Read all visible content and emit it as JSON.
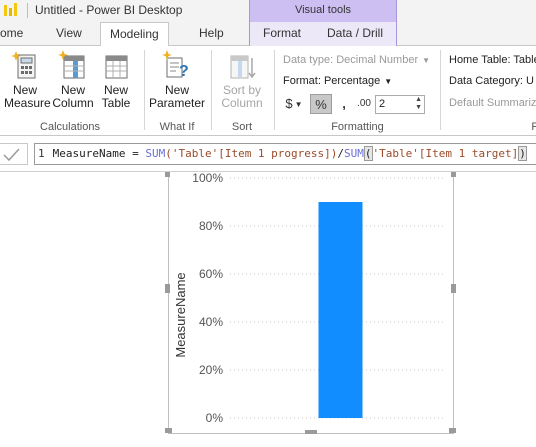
{
  "window": {
    "title": "Untitled - Power BI Desktop"
  },
  "contextual_header": {
    "label": "Visual tools"
  },
  "tabs": [
    {
      "label": "ome",
      "active": false
    },
    {
      "label": "View",
      "active": false
    },
    {
      "label": "Modeling",
      "active": true
    },
    {
      "label": "Help",
      "active": false
    },
    {
      "label": "Format",
      "active": false
    },
    {
      "label": "Data / Drill",
      "active": false
    }
  ],
  "ribbon": {
    "calculations": {
      "new_measure": [
        "New",
        "Measure"
      ],
      "new_column": [
        "New",
        "Column"
      ],
      "new_table": [
        "New",
        "Table"
      ],
      "label": "Calculations"
    },
    "what_if": {
      "new_parameter": [
        "New",
        "Parameter"
      ],
      "label": "What If"
    },
    "sort": {
      "sort_by_column": [
        "Sort by",
        "Column"
      ],
      "label": "Sort"
    },
    "formatting": {
      "data_type": "Data type: Decimal Number",
      "format": "Format: Percentage",
      "currency_symbol": "$",
      "percent_symbol": "%",
      "comma_symbol": ",",
      "decimal_icon_text": ".00",
      "decimal_places": "2",
      "label": "Formatting"
    },
    "properties": {
      "home_table": "Home Table: Table",
      "data_category": "Data Category: U",
      "default_summarization": "Default Summarizat",
      "cutoff_label": "P"
    }
  },
  "formula_bar": {
    "line_number": "1",
    "measure_name": "MeasureName = ",
    "fn1": "SUM",
    "arg1": "('Table'[Item 1 progress])",
    "divider": "/",
    "fn2": "SUM",
    "open_paren": "(",
    "arg2": "'Table'[Item 1 target]",
    "close_paren": ")"
  },
  "chart_data": {
    "type": "bar",
    "categories": [
      ""
    ],
    "values": [
      0.9
    ],
    "ylabel": "MeasureName",
    "ylim": [
      0,
      1
    ],
    "yticks": [
      "0%",
      "20%",
      "40%",
      "60%",
      "80%",
      "100%"
    ],
    "grid": true,
    "bar_color": "#118dff"
  },
  "colors": {
    "context_tab": "#cdbff2",
    "accent_yellow": "#f2c811",
    "bar": "#118dff"
  }
}
